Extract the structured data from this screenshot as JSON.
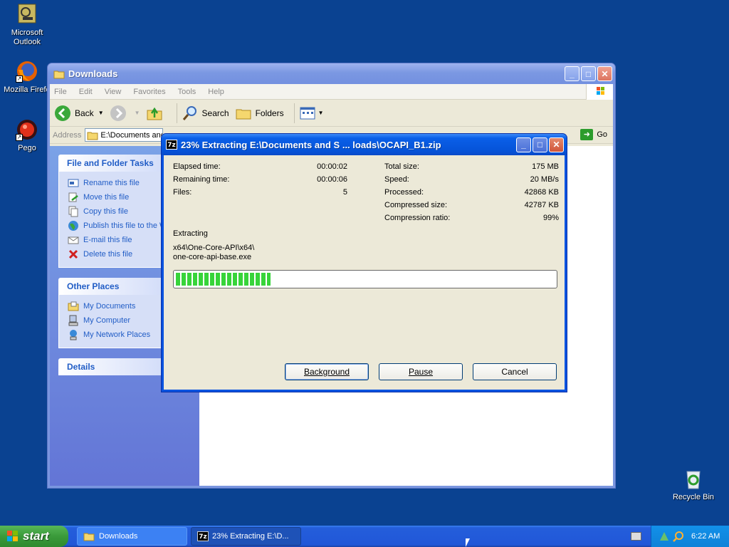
{
  "desktop": {
    "icons": [
      {
        "label_line1": "Microsoft",
        "label_line2": "Outlook",
        "icon": "outlook-icon"
      },
      {
        "label_line1": "Mozilla Firefo",
        "icon": "firefox-icon"
      },
      {
        "label_line1": "Pego",
        "icon": "pego-icon"
      },
      {
        "label_line1": "Recycle Bin",
        "icon": "recycle-bin-icon"
      }
    ]
  },
  "explorer": {
    "title": "Downloads",
    "menu": [
      "File",
      "Edit",
      "View",
      "Favorites",
      "Tools",
      "Help"
    ],
    "toolbar": {
      "back": "Back",
      "search": "Search",
      "folders": "Folders"
    },
    "address": {
      "label": "Address",
      "value": "E:\\Documents and",
      "go": "Go"
    },
    "tasks": {
      "file_folder": {
        "title": "File and Folder Tasks",
        "items": [
          "Rename this file",
          "Move this file",
          "Copy this file",
          "Publish this file to the W",
          "E-mail this file",
          "Delete this file"
        ]
      },
      "other_places": {
        "title": "Other Places",
        "items": [
          "My Documents",
          "My Computer",
          "My Network Places"
        ]
      },
      "details": {
        "title": "Details"
      }
    }
  },
  "dialog": {
    "title": "23% Extracting E:\\Documents and S ... loads\\OCAPI_B1.zip",
    "icon_text": "7z",
    "left_stats": [
      {
        "label": "Elapsed time:",
        "value": "00:00:02"
      },
      {
        "label": "Remaining time:",
        "value": "00:00:06"
      },
      {
        "label": "Files:",
        "value": "5"
      }
    ],
    "right_stats": [
      {
        "label": "Total size:",
        "value": "175 MB"
      },
      {
        "label": "Speed:",
        "value": "20 MB/s"
      },
      {
        "label": "Processed:",
        "value": "42868 KB"
      },
      {
        "label": "Compressed size:",
        "value": "42787 KB"
      },
      {
        "label": "Compression ratio:",
        "value": "99%"
      }
    ],
    "extracting_label": "Extracting",
    "path_line1": "x64\\One-Core-API\\x64\\",
    "path_line2": "one-core-api-base.exe",
    "progress": 0.25,
    "buttons": {
      "background": "Background",
      "pause": "Pause",
      "cancel": "Cancel"
    }
  },
  "taskbar": {
    "start": "start",
    "items": [
      {
        "label": "Downloads"
      },
      {
        "label": "23% Extracting E:\\D..."
      }
    ],
    "clock": "6:22 AM"
  }
}
